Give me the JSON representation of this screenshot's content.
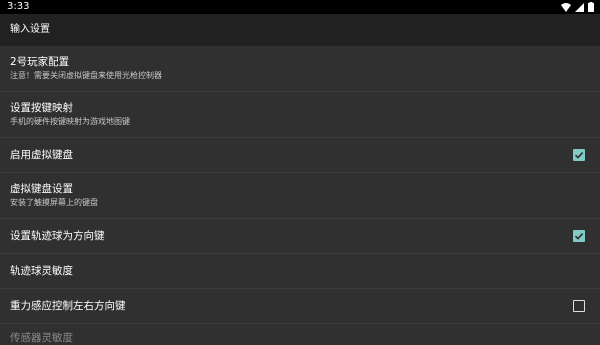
{
  "status_bar": {
    "time": "3:33",
    "icons": [
      "wifi-icon",
      "signal-icon",
      "battery-icon"
    ]
  },
  "app_bar": {
    "title": "输入设置"
  },
  "settings": [
    {
      "title": "2号玩家配置",
      "subtitle": "注意！需要关闭虚拟键盘来使用光枪控制器",
      "checkbox": null
    },
    {
      "title": "设置按键映射",
      "subtitle": "手机的硬件按键映射为游戏地图键",
      "checkbox": null
    },
    {
      "title": "启用虚拟键盘",
      "subtitle": null,
      "checkbox": true
    },
    {
      "title": "虚拟键盘设置",
      "subtitle": "安装了触摸屏幕上的键盘",
      "checkbox": null
    },
    {
      "title": "设置轨迹球为方向键",
      "subtitle": null,
      "checkbox": true
    },
    {
      "title": "轨迹球灵敏度",
      "subtitle": null,
      "checkbox": null
    },
    {
      "title": "重力感应控制左右方向键",
      "subtitle": null,
      "checkbox": false
    },
    {
      "title": "传感器灵敏度",
      "subtitle": null,
      "checkbox": null
    }
  ],
  "colors": {
    "background": "#303030",
    "app_bar": "#212121",
    "status_bar": "#000000",
    "checkbox_accent": "#80cbc4"
  }
}
